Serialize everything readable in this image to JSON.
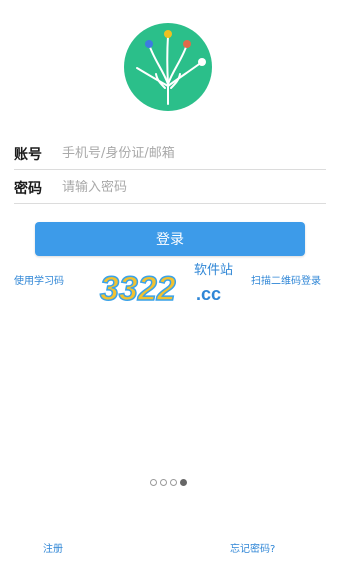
{
  "logo": {
    "name": "tree-logo",
    "bg_color": "#2bbf8a",
    "dot_colors": [
      "#3d7be0",
      "#f0c020",
      "#e06a4a",
      "#ffffff"
    ]
  },
  "login": {
    "account_label": "账号",
    "account_placeholder": "手机号/身份证/邮箱",
    "password_label": "密码",
    "password_placeholder": "请输入密码",
    "submit_label": "登录",
    "accent_color": "#3d9be9"
  },
  "links": {
    "study_code": "使用学习码",
    "qr_login": "扫描二维码登录",
    "register": "注册",
    "forgot_password": "忘记密码?"
  },
  "watermark": {
    "brand": "3322",
    "suffix": ".cc",
    "site": "软件站"
  },
  "pager": {
    "count": 4,
    "active_index": 3
  }
}
